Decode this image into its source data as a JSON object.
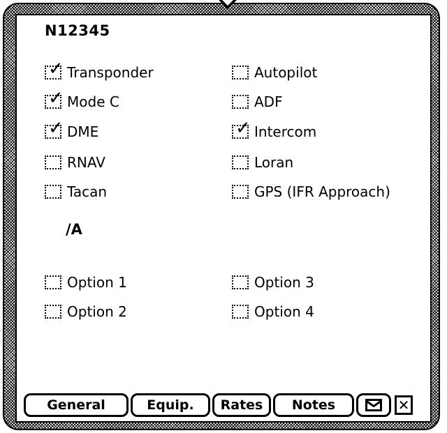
{
  "aircraft": {
    "tail_number": "N12345",
    "suffix": "/A"
  },
  "equipment": {
    "left": [
      {
        "label": "Transponder",
        "checked": true
      },
      {
        "label": "Mode C",
        "checked": true
      },
      {
        "label": "DME",
        "checked": true
      },
      {
        "label": "RNAV",
        "checked": false
      },
      {
        "label": "Tacan",
        "checked": false
      }
    ],
    "right": [
      {
        "label": "Autopilot",
        "checked": false
      },
      {
        "label": "ADF",
        "checked": false
      },
      {
        "label": "Intercom",
        "checked": true
      },
      {
        "label": "Loran",
        "checked": false
      },
      {
        "label": "GPS (IFR Approach)",
        "checked": false
      }
    ]
  },
  "options": {
    "left": [
      {
        "label": "Option 1",
        "checked": false
      },
      {
        "label": "Option 2",
        "checked": false
      }
    ],
    "right": [
      {
        "label": "Option 3",
        "checked": false
      },
      {
        "label": "Option 4",
        "checked": false
      }
    ]
  },
  "check_glyph": "✓",
  "tabs": {
    "general": "General",
    "equip": "Equip.",
    "rates": "Rates",
    "notes": "Notes",
    "mail_icon": "envelope-icon",
    "close": "✕"
  }
}
